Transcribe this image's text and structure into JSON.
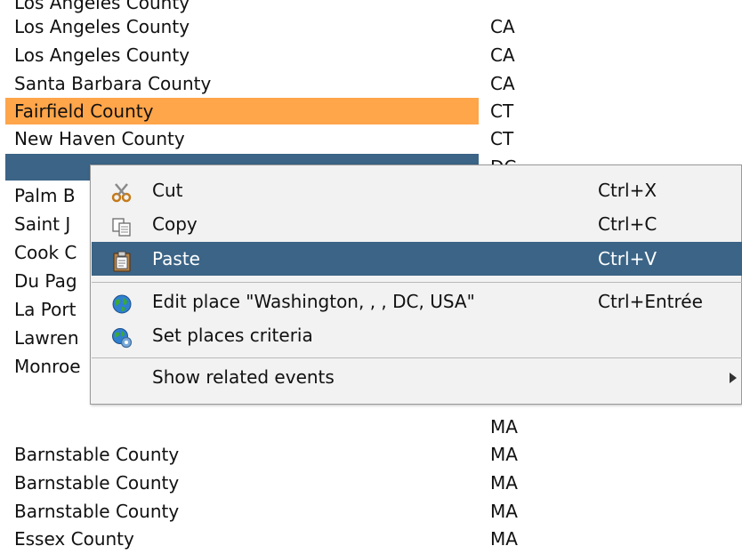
{
  "rows": [
    {
      "county": "Los Angeles County",
      "state": "CA"
    },
    {
      "county": "Los Angeles County",
      "state": "CA"
    },
    {
      "county": "Santa Barbara County",
      "state": "CA"
    },
    {
      "county": "Fairfield County",
      "state": "CT"
    },
    {
      "county": "New Haven County",
      "state": "CT"
    },
    {
      "county": "",
      "state": "DC"
    },
    {
      "county": "Palm B",
      "state": ""
    },
    {
      "county": "Saint J",
      "state": ""
    },
    {
      "county": "Cook C",
      "state": ""
    },
    {
      "county": "Du Pag",
      "state": ""
    },
    {
      "county": "La Port",
      "state": ""
    },
    {
      "county": "Lawren",
      "state": ""
    },
    {
      "county": "Monroe",
      "state": ""
    },
    {
      "county": "",
      "state": "MA"
    },
    {
      "county": "Barnstable County",
      "state": "MA"
    },
    {
      "county": "Barnstable County",
      "state": "MA"
    },
    {
      "county": "Barnstable County",
      "state": "MA"
    },
    {
      "county": "Essex County",
      "state": "MA"
    }
  ],
  "row_colors": {
    "selected_orange": "#ffa54a",
    "selected_blue": "#3b6486"
  },
  "context_menu": {
    "items": [
      {
        "label": "Cut",
        "shortcut": "Ctrl+X",
        "icon": "scissors-icon"
      },
      {
        "label": "Copy",
        "shortcut": "Ctrl+C",
        "icon": "copy-icon"
      },
      {
        "label": "Paste",
        "shortcut": "Ctrl+V",
        "icon": "clipboard-icon",
        "active": true
      },
      {
        "label": "Edit place \"Washington, , , DC, USA\"",
        "shortcut": "Ctrl+Entrée",
        "icon": "globe-icon"
      },
      {
        "label": "Set places criteria",
        "shortcut": "",
        "icon": "globe-gear-icon"
      },
      {
        "label": "Show related events",
        "shortcut": "",
        "icon": "",
        "submenu": true
      }
    ]
  }
}
